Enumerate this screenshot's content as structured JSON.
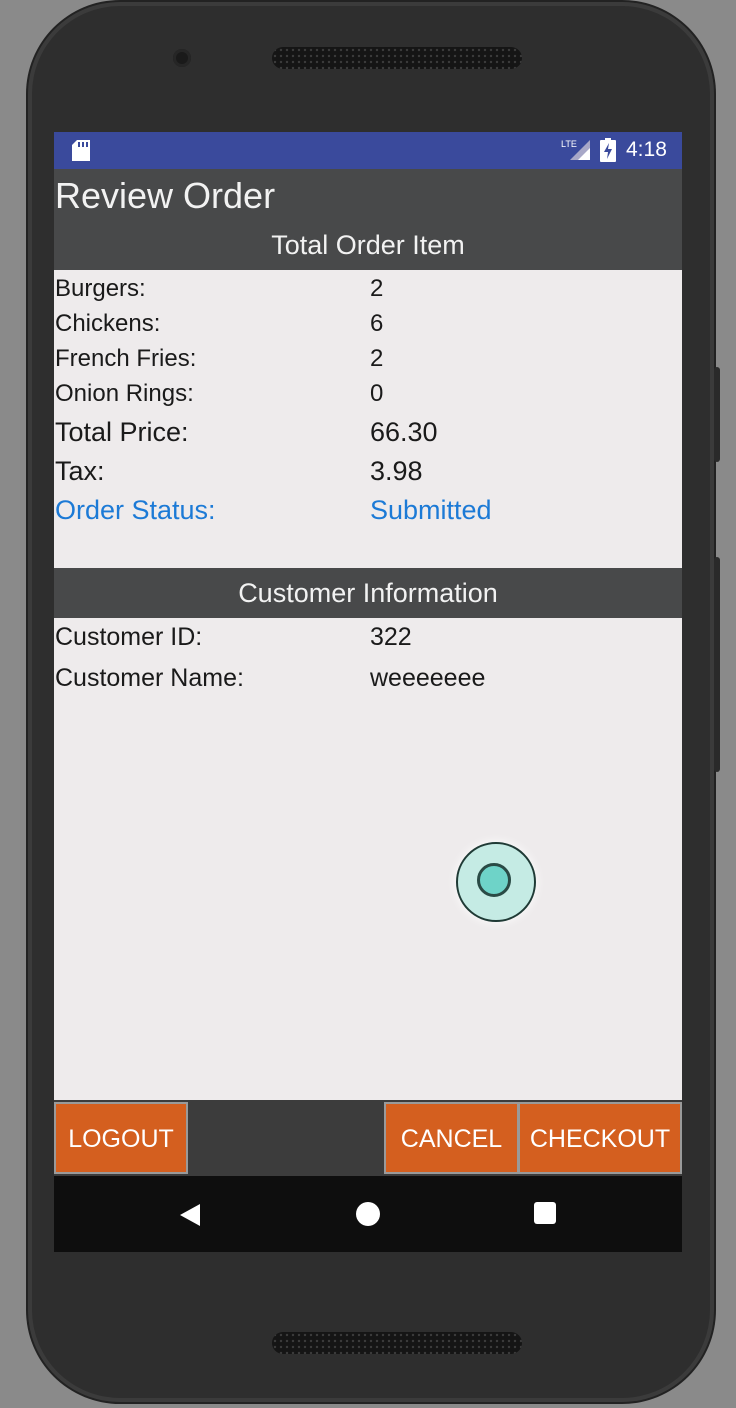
{
  "status_bar": {
    "time": "4:18",
    "network": "LTE"
  },
  "app_bar": {
    "title": "Review Order"
  },
  "order_section": {
    "header": "Total Order Item",
    "rows": [
      {
        "label": "Burgers:",
        "value": "2"
      },
      {
        "label": "Chickens:",
        "value": "6"
      },
      {
        "label": "French Fries:",
        "value": "2"
      },
      {
        "label": "Onion Rings:",
        "value": "0"
      },
      {
        "label": "Total Price:",
        "value": "66.30"
      },
      {
        "label": "Tax:",
        "value": "3.98"
      },
      {
        "label": "Order Status:",
        "value": "Submitted"
      }
    ]
  },
  "customer_section": {
    "header": "Customer Information",
    "rows": [
      {
        "label": "Customer ID:",
        "value": "322"
      },
      {
        "label": "Customer Name:",
        "value": "weeeeeee"
      }
    ]
  },
  "buttons": {
    "logout": "LOGOUT",
    "cancel": "CANCEL",
    "checkout": "CHECKOUT"
  },
  "colors": {
    "accent_button": "#d45f1f",
    "status_bar": "#3a4a9c",
    "header_bg": "#48494a",
    "status_text": "#1c7ad6"
  },
  "icons": [
    "sd-card-icon",
    "lte-signal-icon",
    "battery-charging-icon",
    "back-icon",
    "home-icon",
    "recents-icon"
  ]
}
